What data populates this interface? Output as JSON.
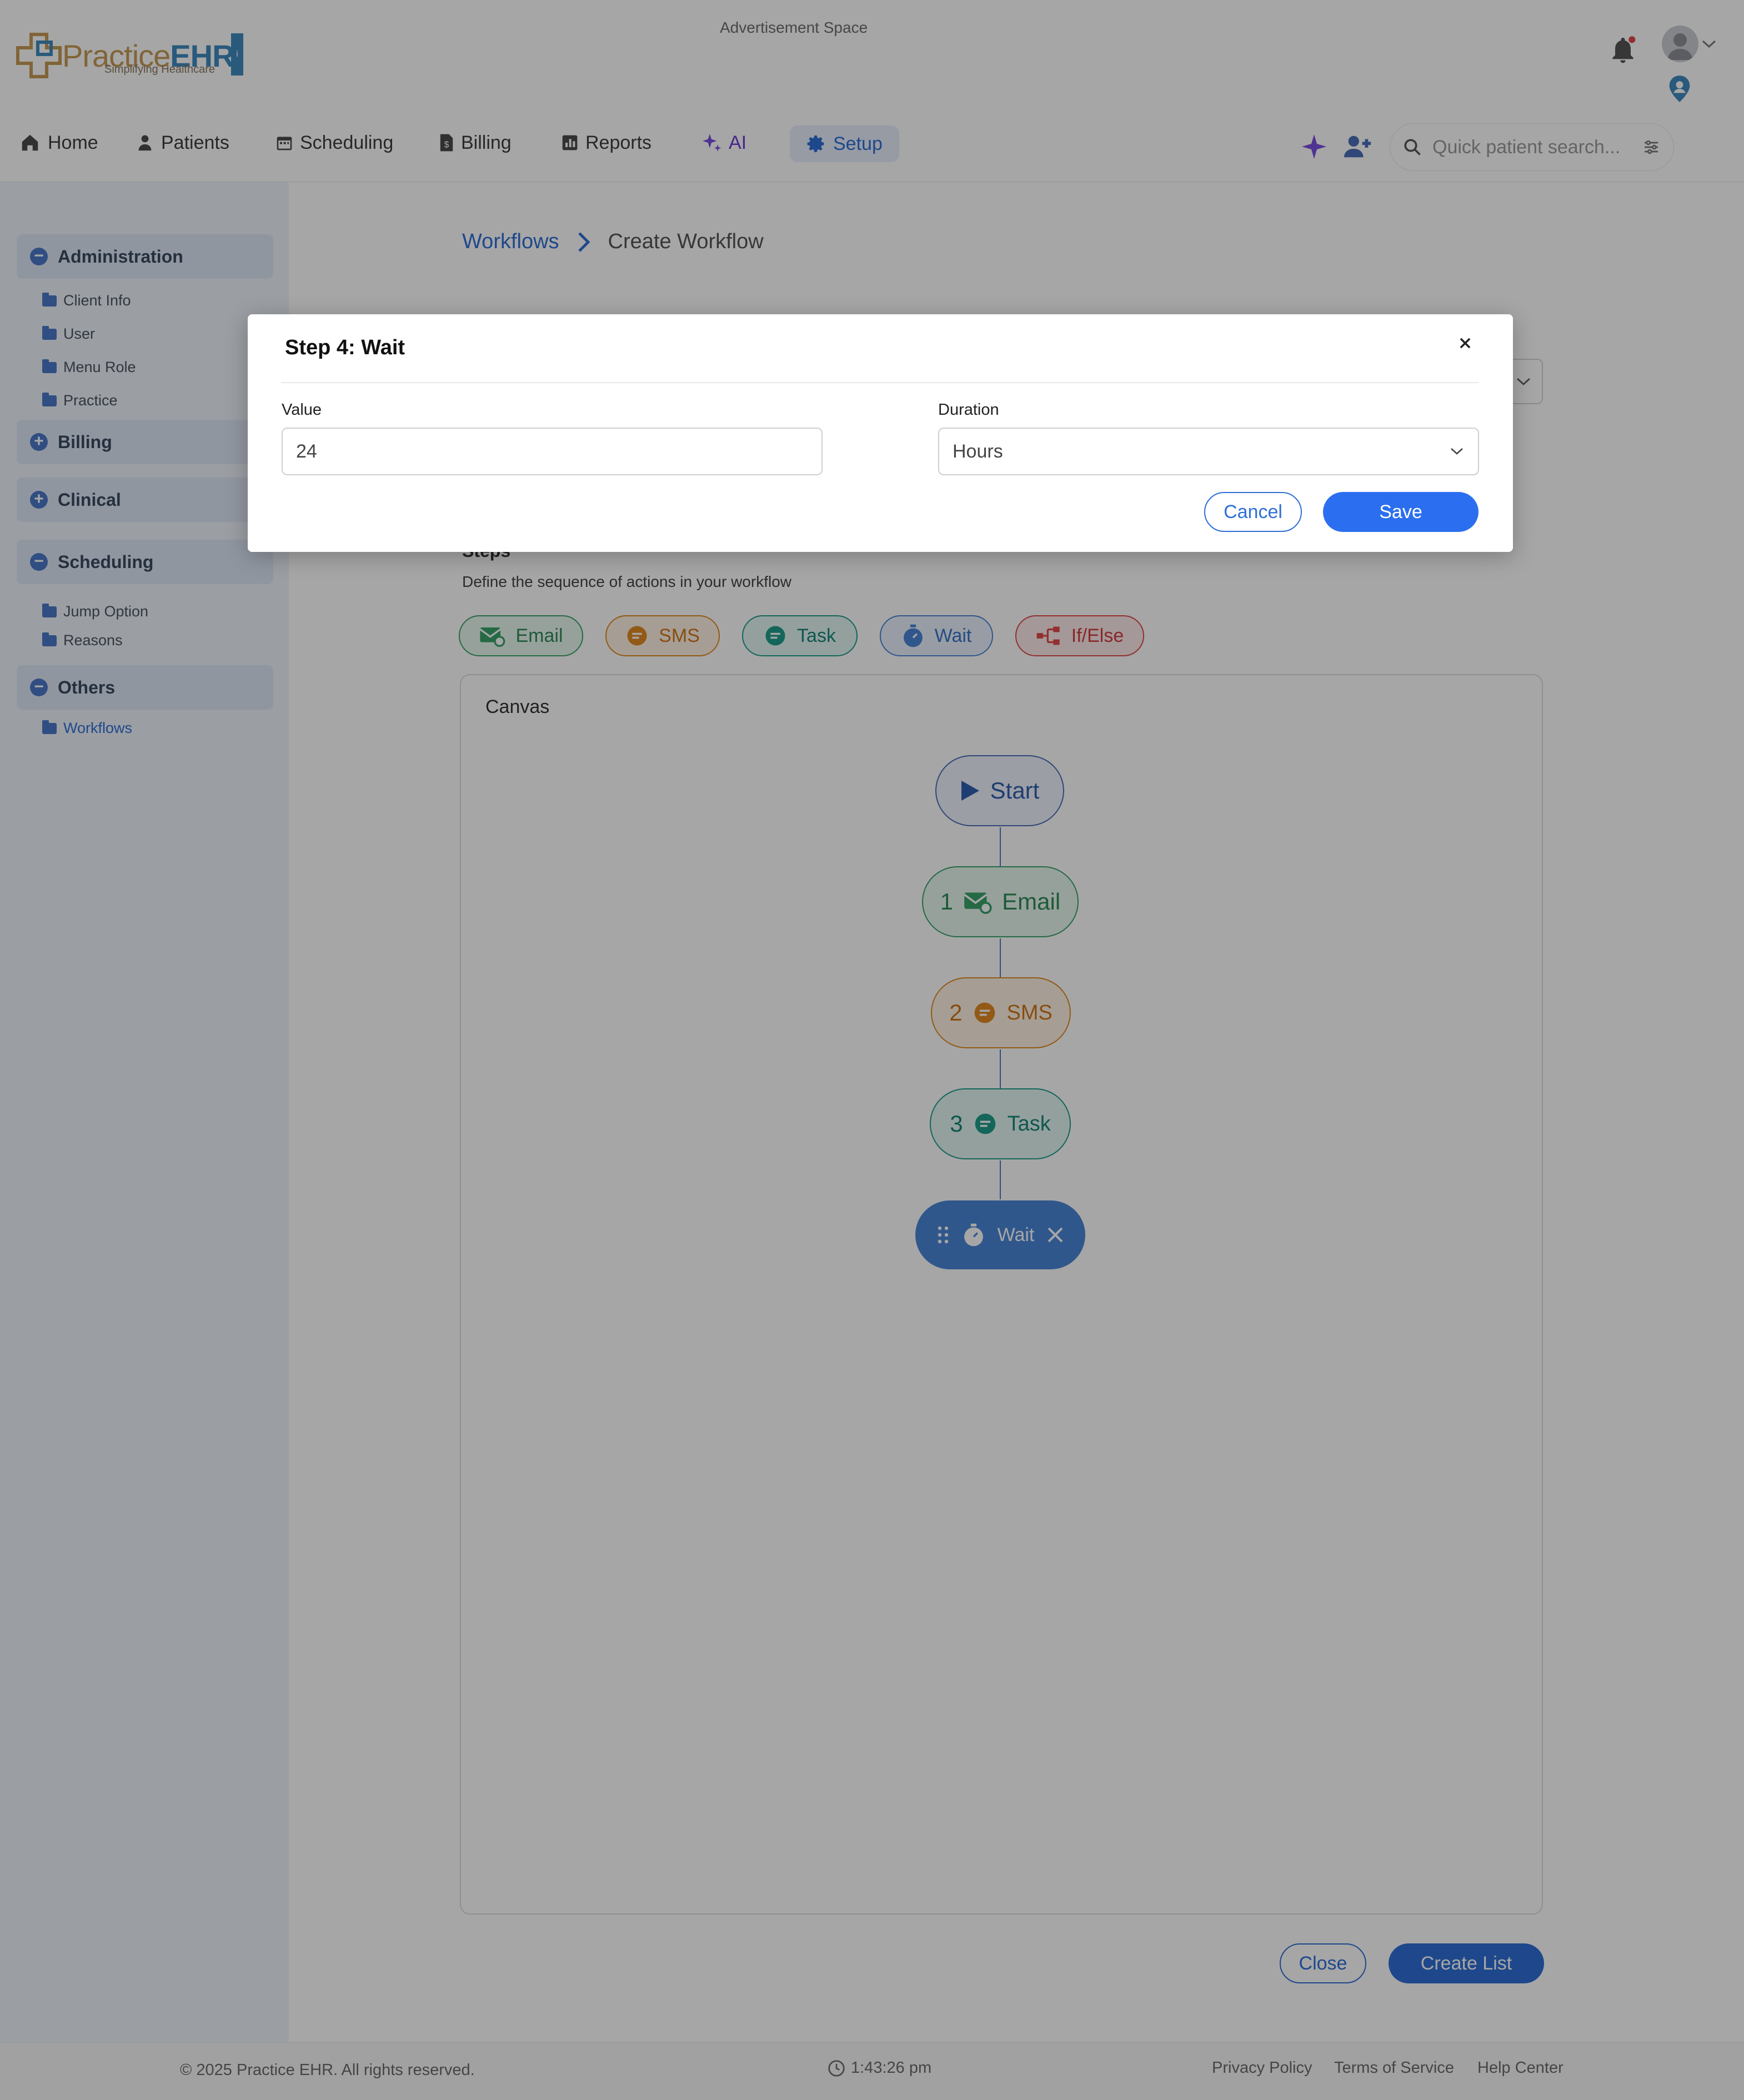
{
  "header": {
    "logo_practice": "Practice",
    "logo_ehr": "EHR",
    "logo_tagline": "Simplifying Healthcare",
    "ad_text": "Advertisement Space"
  },
  "nav": {
    "items": [
      {
        "label": "Home",
        "icon": "home-icon"
      },
      {
        "label": "Patients",
        "icon": "patient-icon"
      },
      {
        "label": "Scheduling",
        "icon": "calendar-icon"
      },
      {
        "label": "Billing",
        "icon": "billing-icon"
      },
      {
        "label": "Reports",
        "icon": "chart-icon"
      },
      {
        "label": "AI",
        "icon": "sparkle-icon"
      },
      {
        "label": "Setup",
        "icon": "gear-icon",
        "active": true
      }
    ],
    "search_placeholder": "Quick patient search..."
  },
  "sidebar": {
    "sections": [
      {
        "label": "Administration",
        "expanded": true,
        "items": [
          "Client Info",
          "User",
          "Menu Role",
          "Practice"
        ]
      },
      {
        "label": "Billing",
        "expanded": false,
        "items": []
      },
      {
        "label": "Clinical",
        "expanded": false,
        "items": []
      },
      {
        "label": "Scheduling",
        "expanded": true,
        "items": [
          "Jump Option",
          "Reasons"
        ]
      },
      {
        "label": "Others",
        "expanded": true,
        "items": [
          "Workflows"
        ]
      }
    ]
  },
  "main": {
    "breadcrumb": {
      "parent": "Workflows",
      "current": "Create Workflow"
    },
    "steps_title": "Steps",
    "steps_desc": "Define the sequence of actions in your workflow",
    "chips": [
      "Email",
      "SMS",
      "Task",
      "Wait",
      "If/Else"
    ],
    "canvas_label": "Canvas",
    "nodes": {
      "start": "Start",
      "n1_num": "1",
      "n1_label": "Email",
      "n2_num": "2",
      "n2_label": "SMS",
      "n3_num": "3",
      "n3_label": "Task",
      "n4_label": "Wait"
    },
    "close_label": "Close",
    "create_label": "Create List"
  },
  "footer": {
    "copyright": "© 2025 Practice EHR. All rights reserved.",
    "time": "1:43:26 pm",
    "links": [
      "Privacy Policy",
      "Terms of Service",
      "Help Center"
    ]
  },
  "modal": {
    "title": "Step 4: Wait",
    "value_label": "Value",
    "value": "24",
    "duration_label": "Duration",
    "duration_value": "Hours",
    "cancel_label": "Cancel",
    "save_label": "Save"
  },
  "colors": {
    "primary": "#2f6fd6",
    "email": "#3aa36b",
    "sms": "#e08a22",
    "task": "#1f9d8a",
    "wait": "#4a86d8",
    "ifelse": "#e04a4a"
  }
}
